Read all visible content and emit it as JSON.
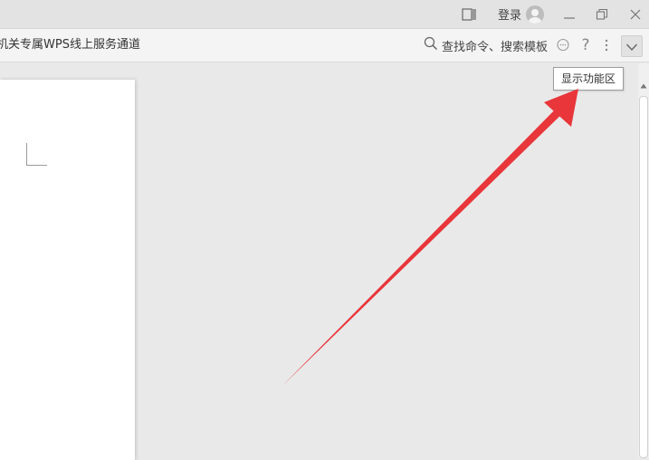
{
  "titlebar": {
    "login_label": "登录",
    "icons": [
      "panel-toggle-icon",
      "avatar",
      "minimize-icon",
      "restore-icon",
      "close-icon"
    ]
  },
  "toolbar": {
    "banner_text": "机关专属WPS线上服务通道",
    "search_label": "查找命令、搜索模板",
    "icons": [
      "search-icon",
      "comment-icon",
      "help-icon",
      "more-icon",
      "chevron-down-icon"
    ]
  },
  "tooltip": {
    "label": "显示功能区"
  },
  "colors": {
    "annotation_arrow": "#e8363a",
    "workspace_bg": "#e9e9e9",
    "page_bg": "#ffffff"
  }
}
